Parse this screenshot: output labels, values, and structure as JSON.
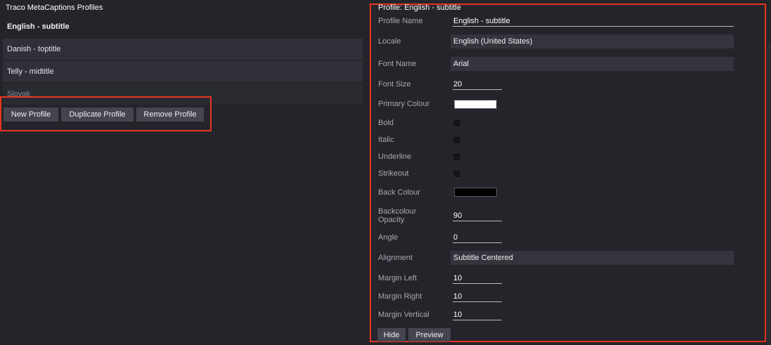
{
  "app": {
    "title": "Traco MetaCaptions Profiles"
  },
  "profiles": {
    "items": [
      {
        "label": "English - subtitle"
      },
      {
        "label": "Danish - toptitle"
      },
      {
        "label": "Telly - midtitle"
      },
      {
        "label": "Slovak"
      }
    ],
    "selected": "English - subtitle"
  },
  "list_buttons": {
    "new_label": "New Profile",
    "duplicate_label": "Duplicate Profile",
    "remove_label": "Remove Profile"
  },
  "editor": {
    "title": "Profile: English - subtitle",
    "fields": {
      "profile_name": {
        "label": "Profile Name",
        "value": "English - subtitle"
      },
      "locale": {
        "label": "Locale",
        "value": "English (United States)"
      },
      "font_name": {
        "label": "Font Name",
        "value": "Arial"
      },
      "font_size": {
        "label": "Font Size",
        "value": "20"
      },
      "primary_colour": {
        "label": "Primary Colour",
        "color": "#ffffff"
      },
      "bold": {
        "label": "Bold",
        "checked": false
      },
      "italic": {
        "label": "Italic",
        "checked": false
      },
      "underline": {
        "label": "Underline",
        "checked": false
      },
      "strikeout": {
        "label": "Strikeout",
        "checked": false
      },
      "back_colour": {
        "label": "Back Colour",
        "color": "#000000"
      },
      "backcolour_opacity": {
        "label_line1": "Backcolour",
        "label_line2": "Opacity",
        "value": "90"
      },
      "angle": {
        "label": "Angle",
        "value": "0"
      },
      "alignment": {
        "label": "Alignment",
        "value": "Subtitle Centered"
      },
      "margin_left": {
        "label": "Margin Left",
        "value": "10"
      },
      "margin_right": {
        "label": "Margin Right",
        "value": "10"
      },
      "margin_vertical": {
        "label": "Margin Vertical",
        "value": "10"
      }
    },
    "buttons": {
      "hide_label": "Hide",
      "preview_label": "Preview"
    }
  },
  "theme": {
    "background": "#24242b",
    "list_item_bg": "#303038",
    "button_bg": "#45454f",
    "highlight_frame": "#e8351f"
  }
}
